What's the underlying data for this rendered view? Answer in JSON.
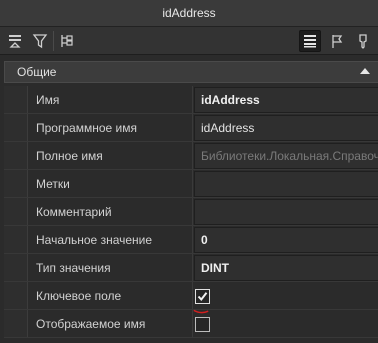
{
  "window": {
    "title": "idAddress"
  },
  "toolbar": {
    "left_icons": [
      "sort-icon",
      "filter-icon",
      "tree-icon"
    ],
    "right_icons": [
      "list-view-icon",
      "flag-icon",
      "pin-icon"
    ]
  },
  "section": {
    "title": "Общие"
  },
  "properties": [
    {
      "label": "Имя",
      "value": "idAddress",
      "style": "bold"
    },
    {
      "label": "Программное имя",
      "value": "idAddress",
      "style": "normal"
    },
    {
      "label": "Полное имя",
      "value": "Библиотеки.Локальная.Справочники",
      "style": "muted"
    },
    {
      "label": "Метки",
      "value": "",
      "style": "normal"
    },
    {
      "label": "Комментарий",
      "value": "",
      "style": "normal"
    },
    {
      "label": "Начальное значение",
      "value": "0",
      "style": "bold"
    },
    {
      "label": "Тип значения",
      "value": "DINT",
      "style": "bold"
    },
    {
      "label": "Ключевое поле",
      "checked": true,
      "style": "checkbox"
    },
    {
      "label": "Отображаемое имя",
      "checked": false,
      "style": "checkbox"
    }
  ],
  "colors": {
    "background": "#2b2b2b",
    "accent_mark": "#d21f1f"
  }
}
